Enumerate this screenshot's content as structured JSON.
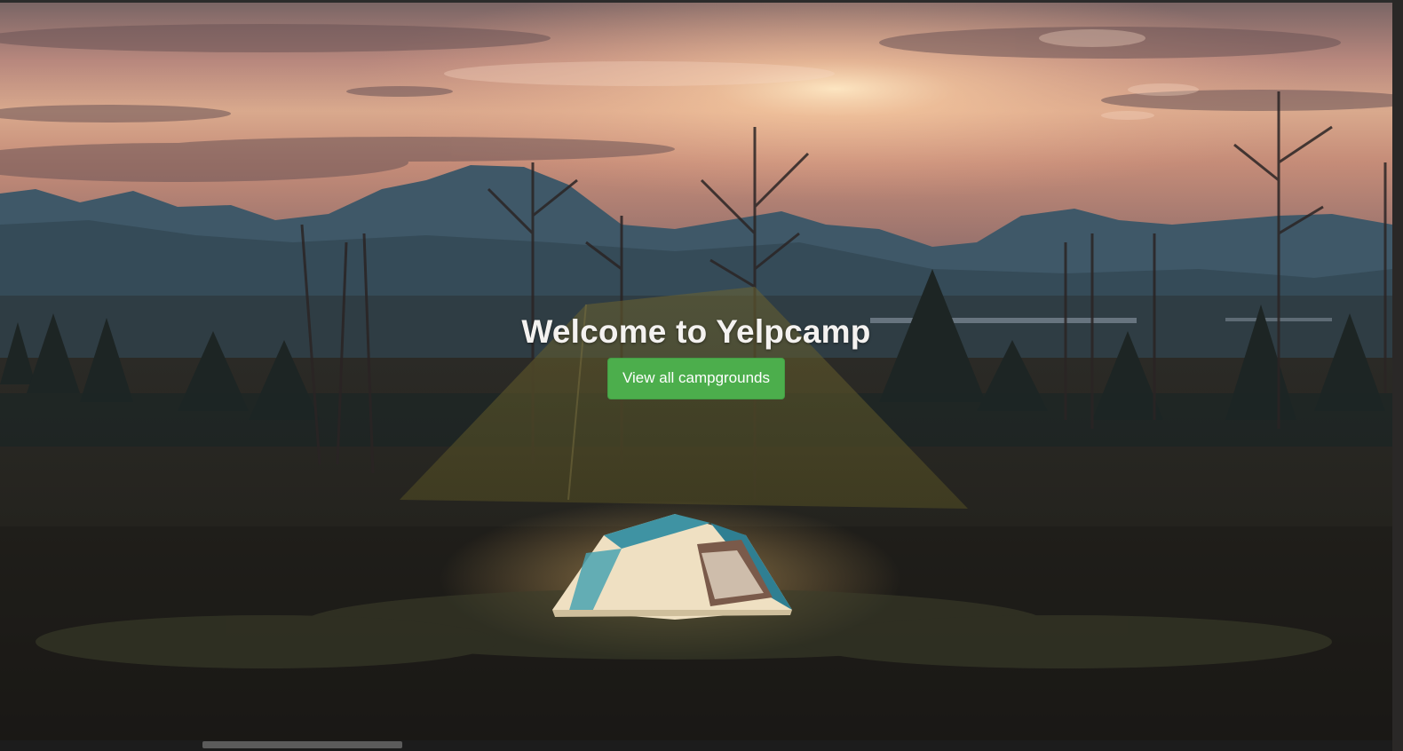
{
  "hero": {
    "title": "Welcome to Yelpcamp",
    "cta_label": "View all campgrounds"
  },
  "colors": {
    "cta_background": "#4cae4c",
    "title_text": "#f4f2f0",
    "sky_glow": "#f3c29a",
    "mountains": "#3d5666",
    "foreground": "#1f1d1a"
  },
  "background_image": {
    "icon": "sunset-campsite-photo"
  },
  "scrollbar": {
    "orientation": "horizontal"
  }
}
